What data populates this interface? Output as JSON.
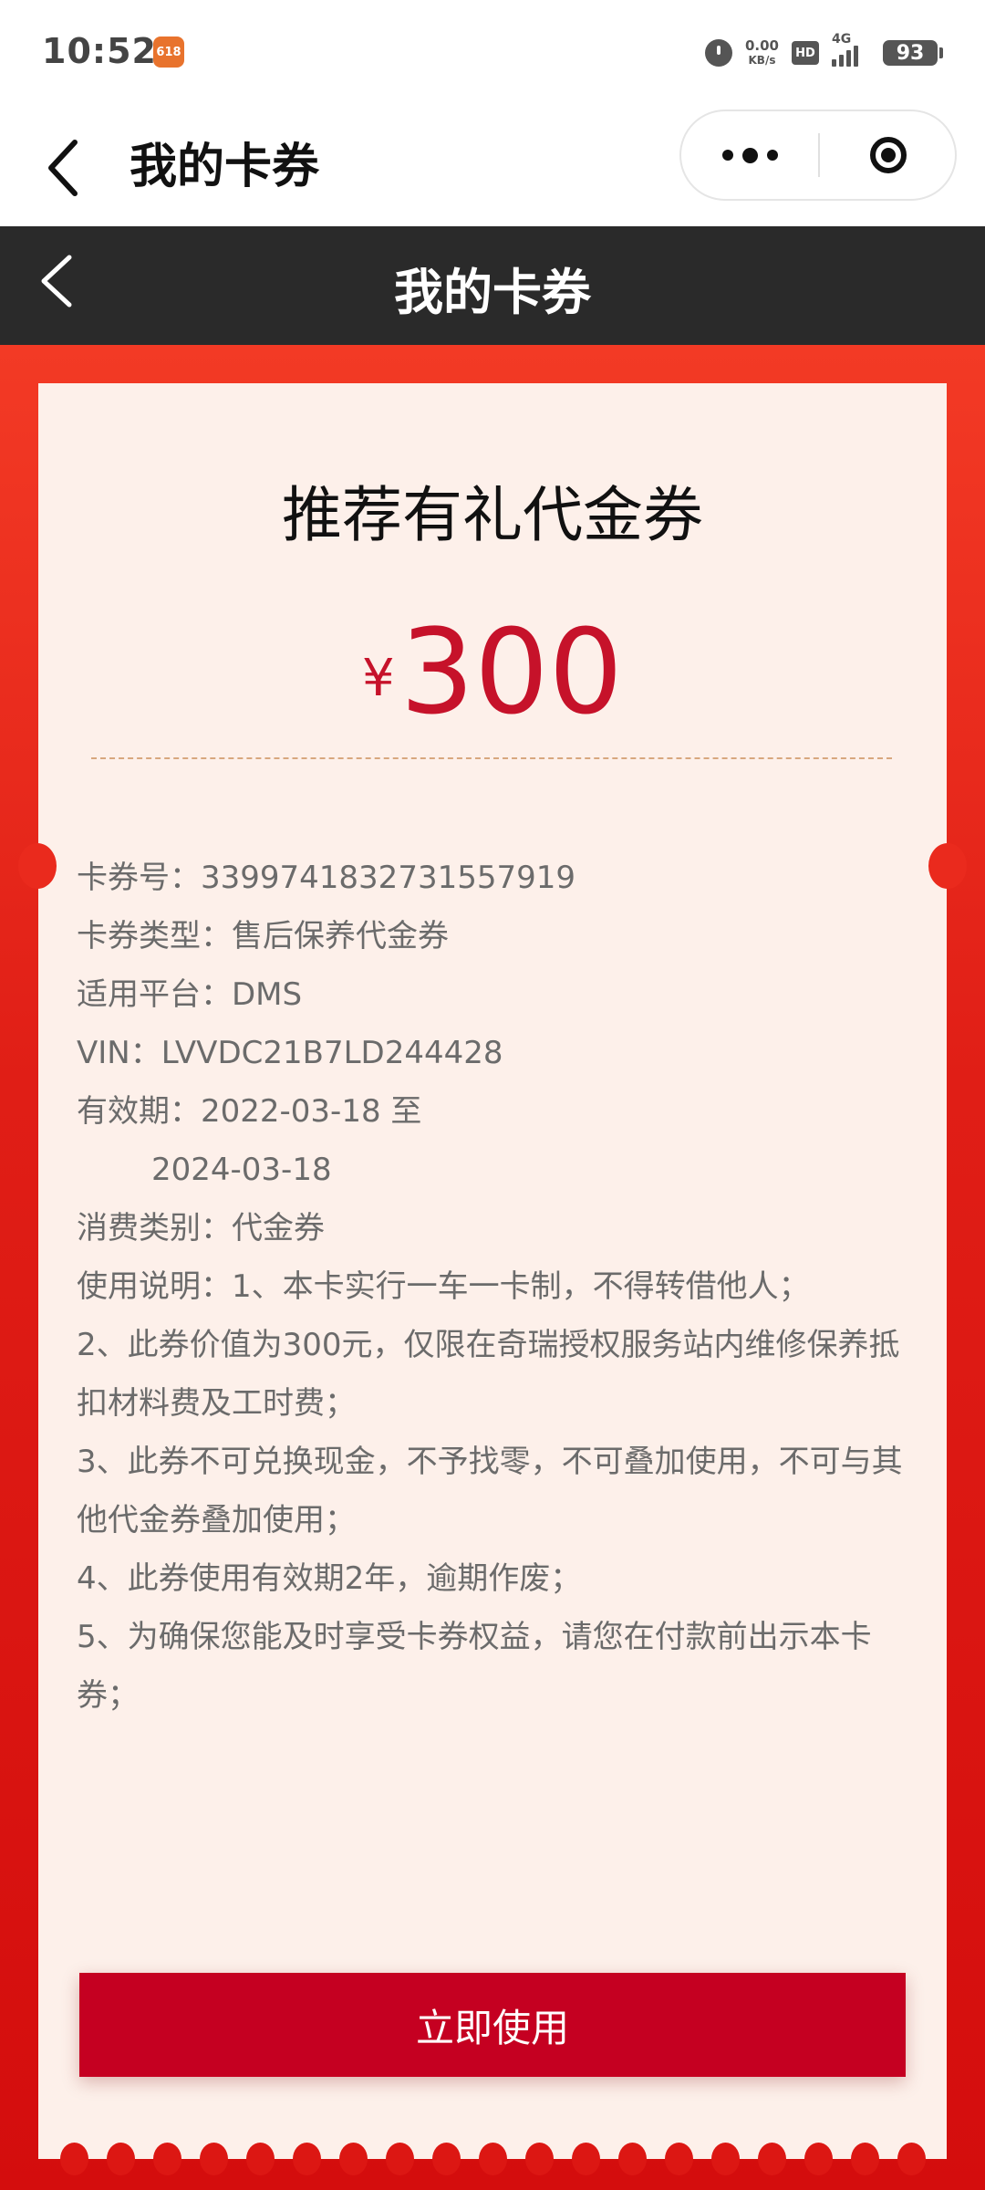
{
  "status_bar": {
    "time": "10:52",
    "app_badge": "618",
    "net_speed_value": "0.00",
    "net_speed_unit": "KB/s",
    "hd_label": "HD",
    "signal_label": "4G",
    "battery": "93",
    "icons": [
      "alarm-icon",
      "hd-icon",
      "signal-icon",
      "battery-icon"
    ]
  },
  "nav": {
    "title": "我的卡券",
    "icons": [
      "back-arrow-icon",
      "more-dots-icon",
      "close-target-icon"
    ]
  },
  "header": {
    "title": "我的卡券"
  },
  "coupon": {
    "title": "推荐有礼代金券",
    "currency": "¥",
    "amount": "300",
    "lines": [
      "卡券号：3399741832731557919",
      "卡券类型：售后保养代金券",
      "适用平台：DMS",
      "VIN：LVVDC21B7LD244428",
      "有效期：2022-03-18 至",
      "2024-03-18",
      "消费类别：代金券",
      "使用说明：1、本卡实行一车一卡制，不得转借他人；",
      "2、此券价值为300元，仅限在奇瑞授权服务站内维修保养抵扣材料费及工时费；",
      "3、此券不可兑换现金，不予找零，不可叠加使用，不可与其他代金券叠加使用；",
      "4、此券使用有效期2年，逾期作废；",
      "5、为确保您能及时享受卡券权益，请您在付款前出示本卡券；"
    ],
    "button_label": "立即使用"
  },
  "colors": {
    "accent_red": "#c50021",
    "background_red": "#e01e16",
    "coupon_bg": "#fdf0ea",
    "header_dark": "#2a2a2a"
  }
}
